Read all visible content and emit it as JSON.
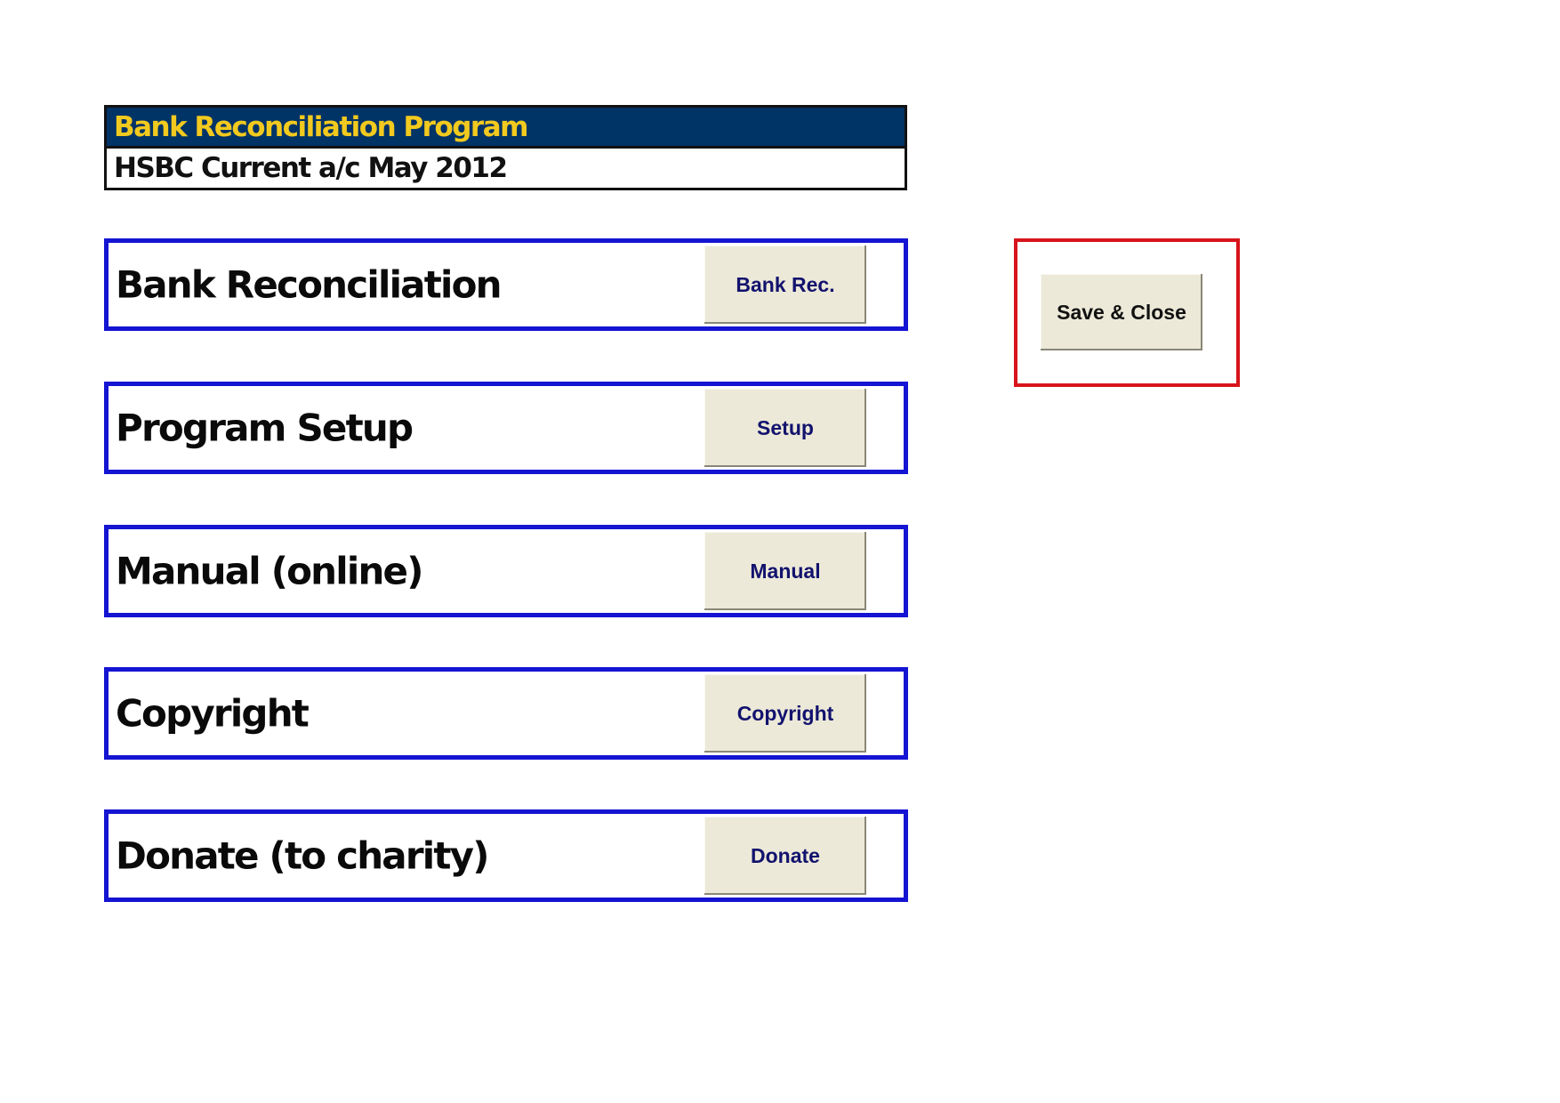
{
  "header": {
    "title": "Bank Reconciliation Program",
    "subtitle": "HSBC Current a/c May 2012"
  },
  "menu": [
    {
      "label": "Bank Reconciliation",
      "button": "Bank Rec."
    },
    {
      "label": "Program Setup",
      "button": "Setup"
    },
    {
      "label": "Manual (online)",
      "button": "Manual"
    },
    {
      "label": "Copyright",
      "button": "Copyright"
    },
    {
      "label": "Donate (to charity)",
      "button": "Donate"
    }
  ],
  "actions": {
    "save_close": "Save & Close"
  },
  "colors": {
    "title_bar_bg": "#003366",
    "title_text": "#F2C91E",
    "menu_border": "#1414D2",
    "save_border": "#D7141A",
    "button_bg": "#ECE9D8",
    "button_text": "#12126E"
  }
}
